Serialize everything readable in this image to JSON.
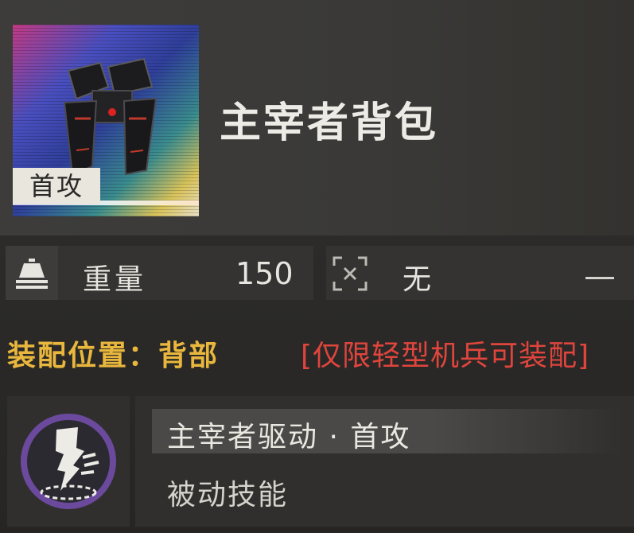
{
  "item": {
    "name": "主宰者背包",
    "tag": "首攻",
    "icon": "mech-backpack-icon"
  },
  "stats": {
    "weight_label": "重量",
    "weight_value": "150",
    "weight_icon": "weight-icon",
    "slot_label": "无",
    "slot_icon": "close-frame-icon",
    "slot_value": "—"
  },
  "equip": {
    "position_text": "装配位置：背部",
    "limit_text": "[仅限轻型机兵可装配]"
  },
  "skill": {
    "icon": "skill-emblem-icon",
    "title": "主宰者驱动 · 首攻",
    "description": "被动技能"
  },
  "colors": {
    "accent_yellow": "#e9b73d",
    "warning_red": "#e0453d",
    "skill_ring_purple": "#6b4a9e",
    "panel_dark": "#302f2d"
  }
}
